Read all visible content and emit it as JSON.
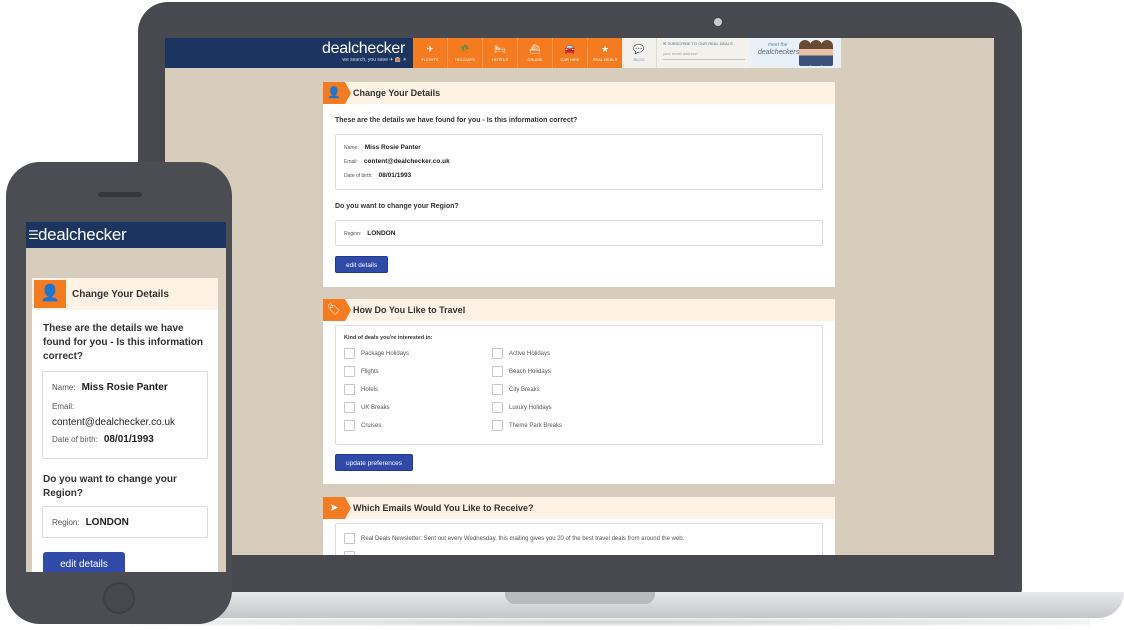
{
  "header": {
    "logo": "dealchecker",
    "tagline": "we search, you save ✈ 🏨 ☀",
    "nav": [
      {
        "label": "FLIGHTS",
        "icon": "✈",
        "icon_name": "plane-icon"
      },
      {
        "label": "HOLIDAYS",
        "icon": "🌴",
        "icon_name": "palm-tree-icon"
      },
      {
        "label": "HOTELS",
        "icon": "🛏",
        "icon_name": "bed-icon"
      },
      {
        "label": "CRUISE",
        "icon": "⛴",
        "icon_name": "ship-icon"
      },
      {
        "label": "CAR HIRE",
        "icon": "🚘",
        "icon_name": "car-icon"
      },
      {
        "label": "REAL DEALS",
        "icon": "★",
        "icon_name": "star-icon"
      }
    ],
    "blog": {
      "label": "BLOG",
      "icon": "💬"
    },
    "subscribe": {
      "label": "✉ SUBSCRIBE TO OUR REAL DEALS",
      "placeholder": "your email address*"
    },
    "meet": {
      "line1": "meet the",
      "line2": "dealcheckers"
    }
  },
  "details": {
    "title": "Change Your Details",
    "question": "These are the details we have found for you - Is this information correct?",
    "name_label": "Name:",
    "name": "Miss Rosie Panter",
    "email_label": "Email:",
    "email": "content@dealchecker.co.uk",
    "dob_label": "Date of birth:",
    "dob": "08/01/1993",
    "region_question": "Do you want to change your Region?",
    "region_label": "Region:",
    "region": "LONDON",
    "edit_button": "edit details"
  },
  "travel": {
    "title": "How Do You Like to Travel",
    "box_label": "Kind of deals you're interested in:",
    "left": [
      "Package Holidays",
      "Flights",
      "Hotels",
      "UK Breaks",
      "Cruises"
    ],
    "right": [
      "Active Holidays",
      "Beach Holidays",
      "City Breaks",
      "Luxury Holidays",
      "Theme Park Breaks"
    ],
    "update_button": "update preferences"
  },
  "emails": {
    "title": "Which Emails Would You Like to Receive?",
    "newsletter": "Real Deals Newsletter: Sent out every Wednesday, this mailing gives you 20 of the best travel deals from around the web."
  },
  "colors": {
    "navy": "#1b3560",
    "orange": "#f47b20",
    "button": "#2f4aa8",
    "page_bg": "#d6cdbd"
  }
}
